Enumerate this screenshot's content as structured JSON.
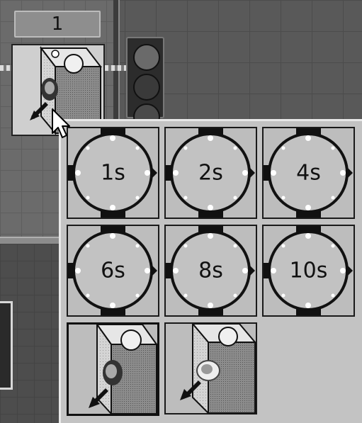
{
  "counter": {
    "value": "1"
  },
  "selected_component": {
    "name": "sensor-block"
  },
  "timer_menu": {
    "items": [
      {
        "label": "1s"
      },
      {
        "label": "2s"
      },
      {
        "label": "4s"
      },
      {
        "label": "6s"
      },
      {
        "label": "8s"
      },
      {
        "label": "10s"
      }
    ]
  },
  "sensor_menu": {
    "items": [
      {
        "icon": "sensor-block-icon"
      },
      {
        "icon": "emitter-block-icon"
      }
    ]
  },
  "colors": {
    "tile_face": "#c8c8c8",
    "clock_face": "#c0c0c0",
    "dark": "#111111"
  }
}
